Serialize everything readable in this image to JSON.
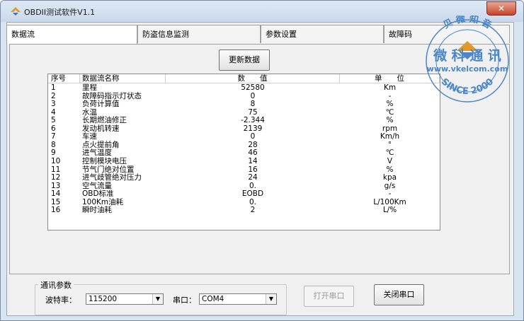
{
  "window": {
    "title": "OBDII测试软件V1.1",
    "close_glyph": "✕"
  },
  "tabs": [
    {
      "label": "数据流"
    },
    {
      "label": "防盗信息监测"
    },
    {
      "label": "参数设置"
    },
    {
      "label": "故障码"
    }
  ],
  "update_button": "更新数据",
  "table": {
    "headers": [
      "序号",
      "数据流名称",
      "数　　值",
      "单　　位"
    ],
    "rows": [
      [
        "1",
        "里程",
        "52580",
        "Km"
      ],
      [
        "2",
        "故障码指示灯状态",
        "0",
        "-"
      ],
      [
        "3",
        "负荷计算值",
        "8",
        "%"
      ],
      [
        "4",
        "水温",
        "75",
        "℃"
      ],
      [
        "5",
        "长期燃油修正",
        "-2.344",
        "%"
      ],
      [
        "6",
        "发动机转速",
        "2139",
        "rpm"
      ],
      [
        "7",
        "车速",
        "0",
        "Km/h"
      ],
      [
        "8",
        "点火提前角",
        "28",
        "°"
      ],
      [
        "9",
        "进气温度",
        "46",
        "℃"
      ],
      [
        "10",
        "控制模块电压",
        "14",
        "V"
      ],
      [
        "11",
        "节气门绝对位置",
        "16",
        "%"
      ],
      [
        "12",
        "进气歧管绝对压力",
        "24",
        "kpa"
      ],
      [
        "13",
        "空气流量",
        "0.",
        "g/s"
      ],
      [
        "14",
        "OBD标准",
        "EOBD",
        "-"
      ],
      [
        "15",
        "100Km油耗",
        "0.",
        "L/100Km"
      ],
      [
        "16",
        "瞬时油耗",
        "2",
        "L/%"
      ]
    ]
  },
  "comm": {
    "group_title": "通讯参数",
    "baud_label": "波特率：",
    "baud_value": "115200",
    "port_label": "串口：",
    "port_value": "COM4",
    "open_button": "打开串口",
    "close_button": "关闭串口"
  },
  "watermark": {
    "top_text": "贝 微 知 音",
    "main_text": "微 科 通 讯",
    "url": "www.vkelcom.com",
    "bottom_text": "SINCE 2000",
    "color": "#4a86c8"
  }
}
